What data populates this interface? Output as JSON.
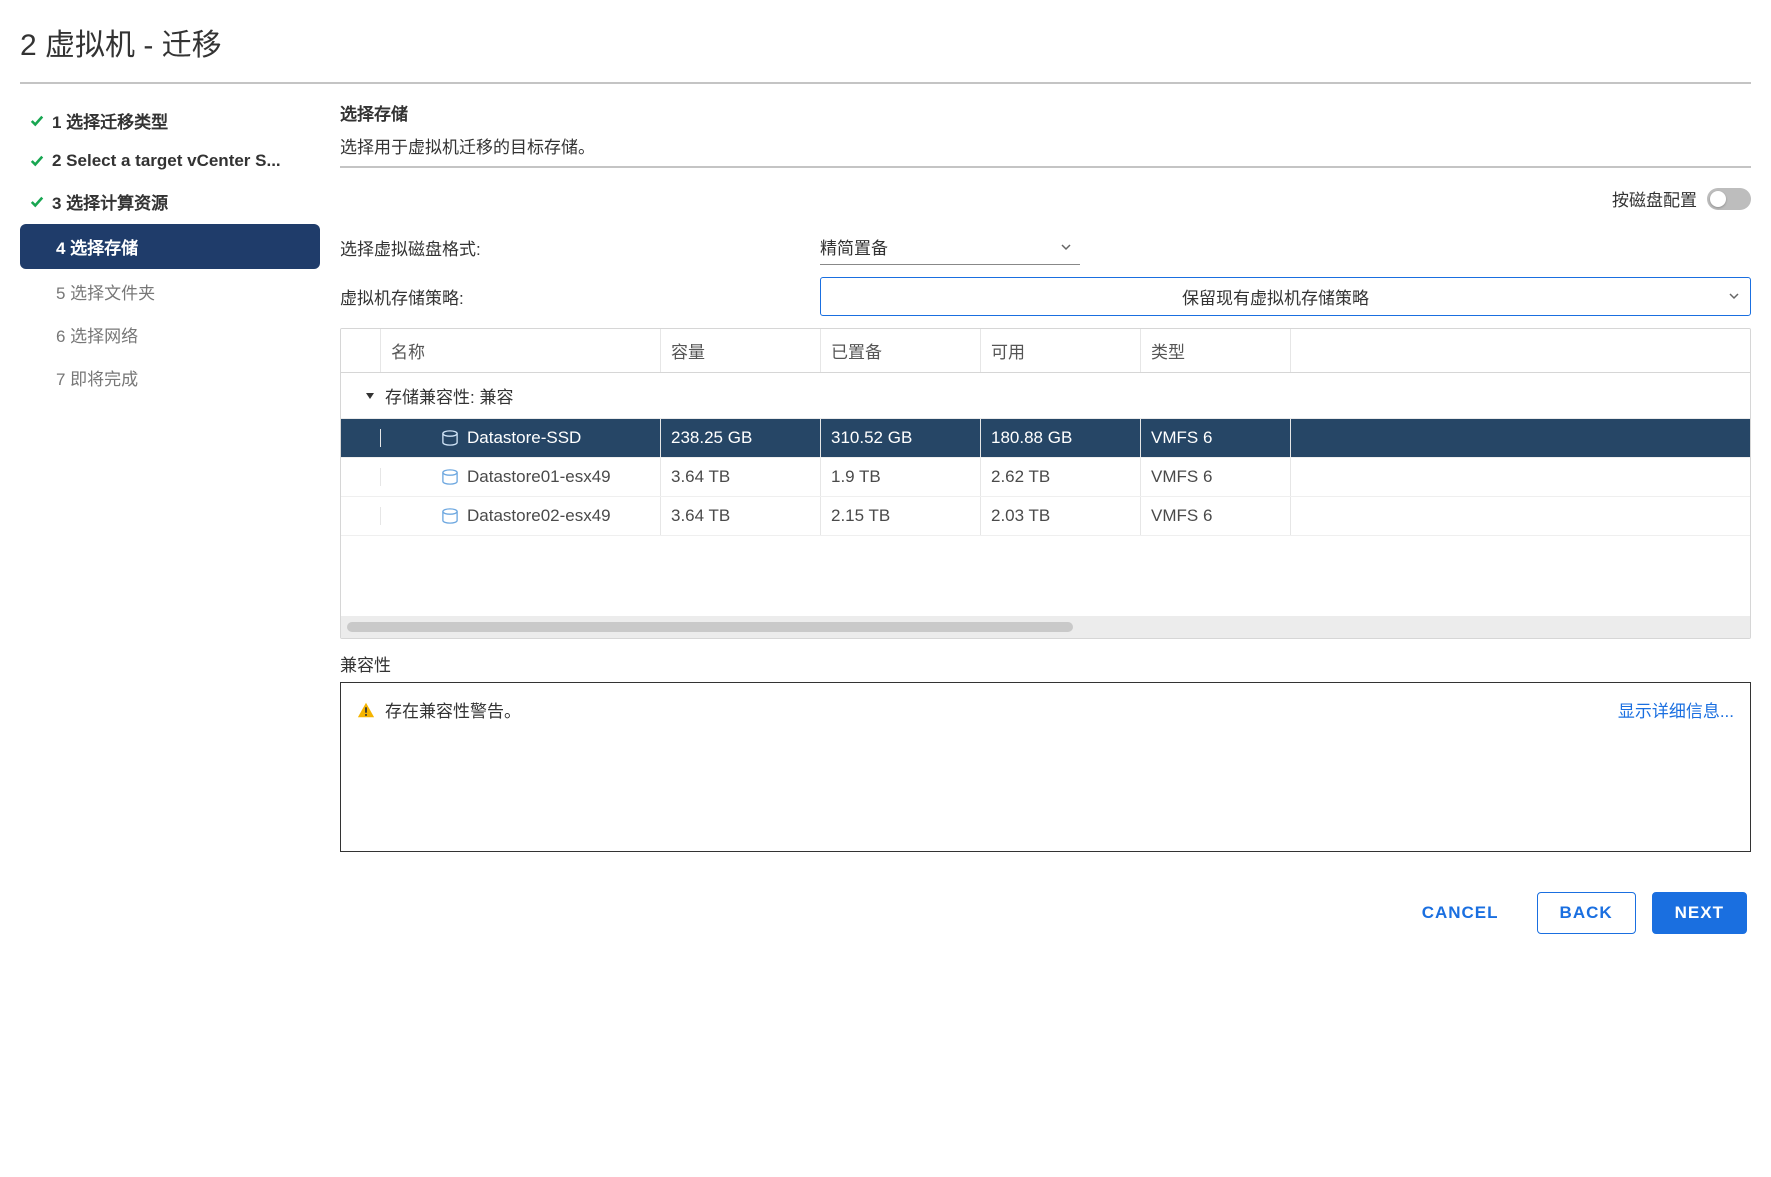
{
  "title": "2 虚拟机 - 迁移",
  "steps": [
    {
      "label": "1 选择迁移类型",
      "state": "done"
    },
    {
      "label": "2 Select a target vCenter S...",
      "state": "done"
    },
    {
      "label": "3 选择计算资源",
      "state": "done"
    },
    {
      "label": "4 选择存储",
      "state": "active"
    },
    {
      "label": "5 选择文件夹",
      "state": "upcoming"
    },
    {
      "label": "6 选择网络",
      "state": "upcoming"
    },
    {
      "label": "7 即将完成",
      "state": "upcoming"
    }
  ],
  "section": {
    "title": "选择存储",
    "desc": "选择用于虚拟机迁移的目标存储。"
  },
  "toggle_label": "按磁盘配置",
  "disk_format_label": "选择虚拟磁盘格式:",
  "disk_format_value": "精简置备",
  "policy_label": "虚拟机存储策略:",
  "policy_value": "保留现有虚拟机存储策略",
  "table": {
    "headers": {
      "name": "名称",
      "capacity": "容量",
      "provisioned": "已置备",
      "free": "可用",
      "type": "类型"
    },
    "group_label": "存储兼容性: 兼容",
    "rows": [
      {
        "name": "Datastore-SSD",
        "capacity": "238.25 GB",
        "provisioned": "310.52 GB",
        "free": "180.88 GB",
        "type": "VMFS 6",
        "selected": true
      },
      {
        "name": "Datastore01-esx49",
        "capacity": "3.64 TB",
        "provisioned": "1.9 TB",
        "free": "2.62 TB",
        "type": "VMFS 6",
        "selected": false
      },
      {
        "name": "Datastore02-esx49",
        "capacity": "3.64 TB",
        "provisioned": "2.15 TB",
        "free": "2.03 TB",
        "type": "VMFS 6",
        "selected": false
      }
    ]
  },
  "compat": {
    "heading": "兼容性",
    "warning_text": "存在兼容性警告。",
    "detail_link": "显示详细信息..."
  },
  "footer": {
    "cancel": "CANCEL",
    "back": "BACK",
    "next": "NEXT"
  }
}
